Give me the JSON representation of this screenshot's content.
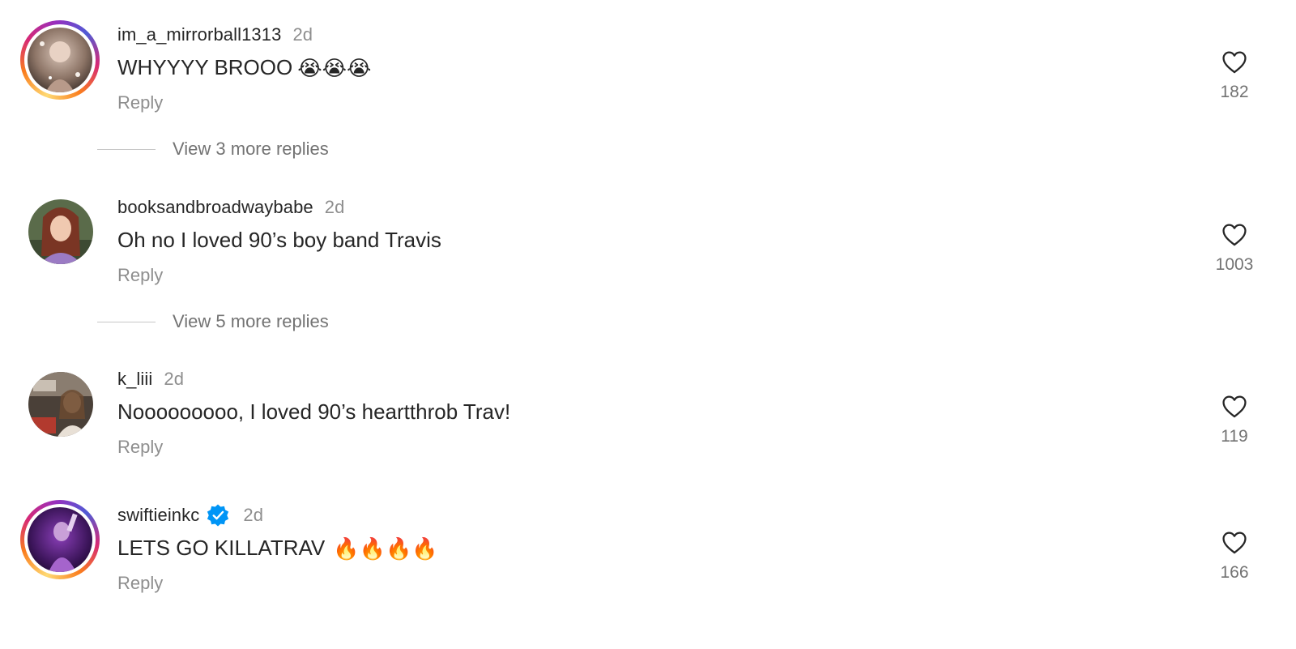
{
  "comments": [
    {
      "username": "im_a_mirrorball1313",
      "time": "2d",
      "text": "WHYYYY BROOO",
      "emoji": "😭😭😭",
      "reply_label": "Reply",
      "likes": "182",
      "avatar_ring": true,
      "verified": false,
      "view_more": "View 3 more replies"
    },
    {
      "username": "booksandbroadwaybabe",
      "time": "2d",
      "text": "Oh no I loved 90’s boy band Travis",
      "emoji": "",
      "reply_label": "Reply",
      "likes": "1003",
      "avatar_ring": false,
      "verified": false,
      "view_more": "View 5 more replies"
    },
    {
      "username": "k_liii",
      "time": "2d",
      "text": "Nooooooooo, I loved 90’s heartthrob Trav!",
      "emoji": "",
      "reply_label": "Reply",
      "likes": "119",
      "avatar_ring": false,
      "verified": false,
      "view_more": ""
    },
    {
      "username": "swiftieinkc",
      "time": "2d",
      "text": "LETS GO KILLATRAV",
      "emoji": "🔥🔥🔥🔥",
      "reply_label": "Reply",
      "likes": "166",
      "avatar_ring": true,
      "verified": true,
      "view_more": ""
    }
  ],
  "colors": {
    "text": "#262626",
    "secondary": "#8e8e8e",
    "verified": "#0095f6"
  },
  "icons": {
    "like": "heart-icon",
    "verified": "verified-badge-icon"
  }
}
